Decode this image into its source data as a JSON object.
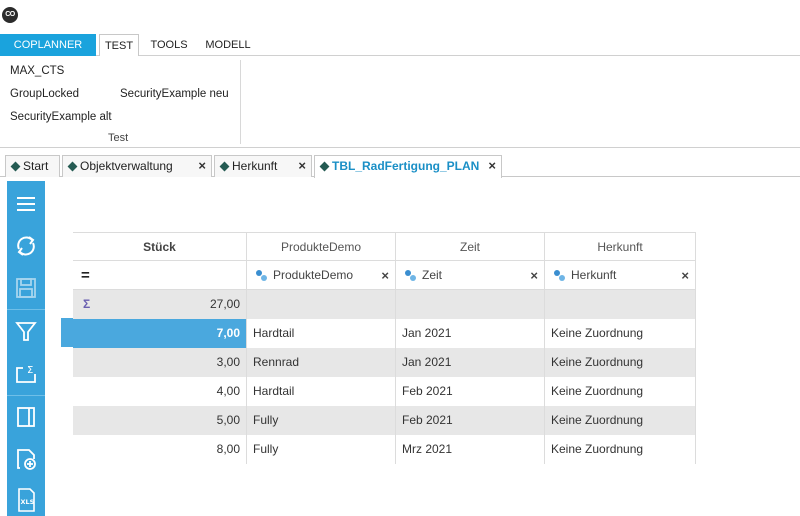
{
  "app": {
    "logo_text": "CO"
  },
  "ribbon": {
    "tabs": [
      {
        "label": "COPLANNER"
      },
      {
        "label": "TEST"
      },
      {
        "label": "TOOLS"
      },
      {
        "label": "MODELL"
      }
    ],
    "buttons": [
      "MAX_CTS",
      "GroupLocked",
      "SecurityExample neu",
      "SecurityExample alt"
    ],
    "group_label": "Test"
  },
  "doc_tabs": [
    {
      "label": "Start",
      "closable": false
    },
    {
      "label": "Objektverwaltung",
      "closable": true
    },
    {
      "label": "Herkunft",
      "closable": true
    },
    {
      "label": "TBL_RadFertigung_PLAN",
      "closable": true,
      "active": true
    }
  ],
  "doc_tab_close_glyph": "×",
  "toolbar": {
    "icons": [
      "menu-icon",
      "refresh-icon",
      "save-icon",
      "filter-icon",
      "sum-icon",
      "panel-icon",
      "add-page-icon",
      "xls-export-icon"
    ]
  },
  "grid": {
    "columns": [
      "Stück",
      "ProdukteDemo",
      "Zeit",
      "Herkunft"
    ],
    "filter_row": {
      "first_symbol": "=",
      "filters": [
        "ProdukteDemo",
        "Zeit",
        "Herkunft"
      ],
      "close_glyph": "×"
    },
    "sum_row": {
      "symbol": "Σ",
      "value": "27,00"
    },
    "rows": [
      {
        "stueck": "7,00",
        "produkt": "Hardtail",
        "zeit": "Jan 2021",
        "herkunft": "Keine Zuordnung"
      },
      {
        "stueck": "3,00",
        "produkt": "Rennrad",
        "zeit": "Jan 2021",
        "herkunft": "Keine Zuordnung"
      },
      {
        "stueck": "4,00",
        "produkt": "Hardtail",
        "zeit": "Feb 2021",
        "herkunft": "Keine Zuordnung"
      },
      {
        "stueck": "5,00",
        "produkt": "Fully",
        "zeit": "Feb 2021",
        "herkunft": "Keine Zuordnung"
      },
      {
        "stueck": "8,00",
        "produkt": "Fully",
        "zeit": "Mrz 2021",
        "herkunft": "Keine Zuordnung"
      }
    ],
    "selected_row": 0
  },
  "colors": {
    "accent": "#1aa3dd",
    "toolbar": "#39a3db",
    "selection": "#4aa8de",
    "zebra": "#e7e7e7",
    "diamond": "#245a52"
  }
}
